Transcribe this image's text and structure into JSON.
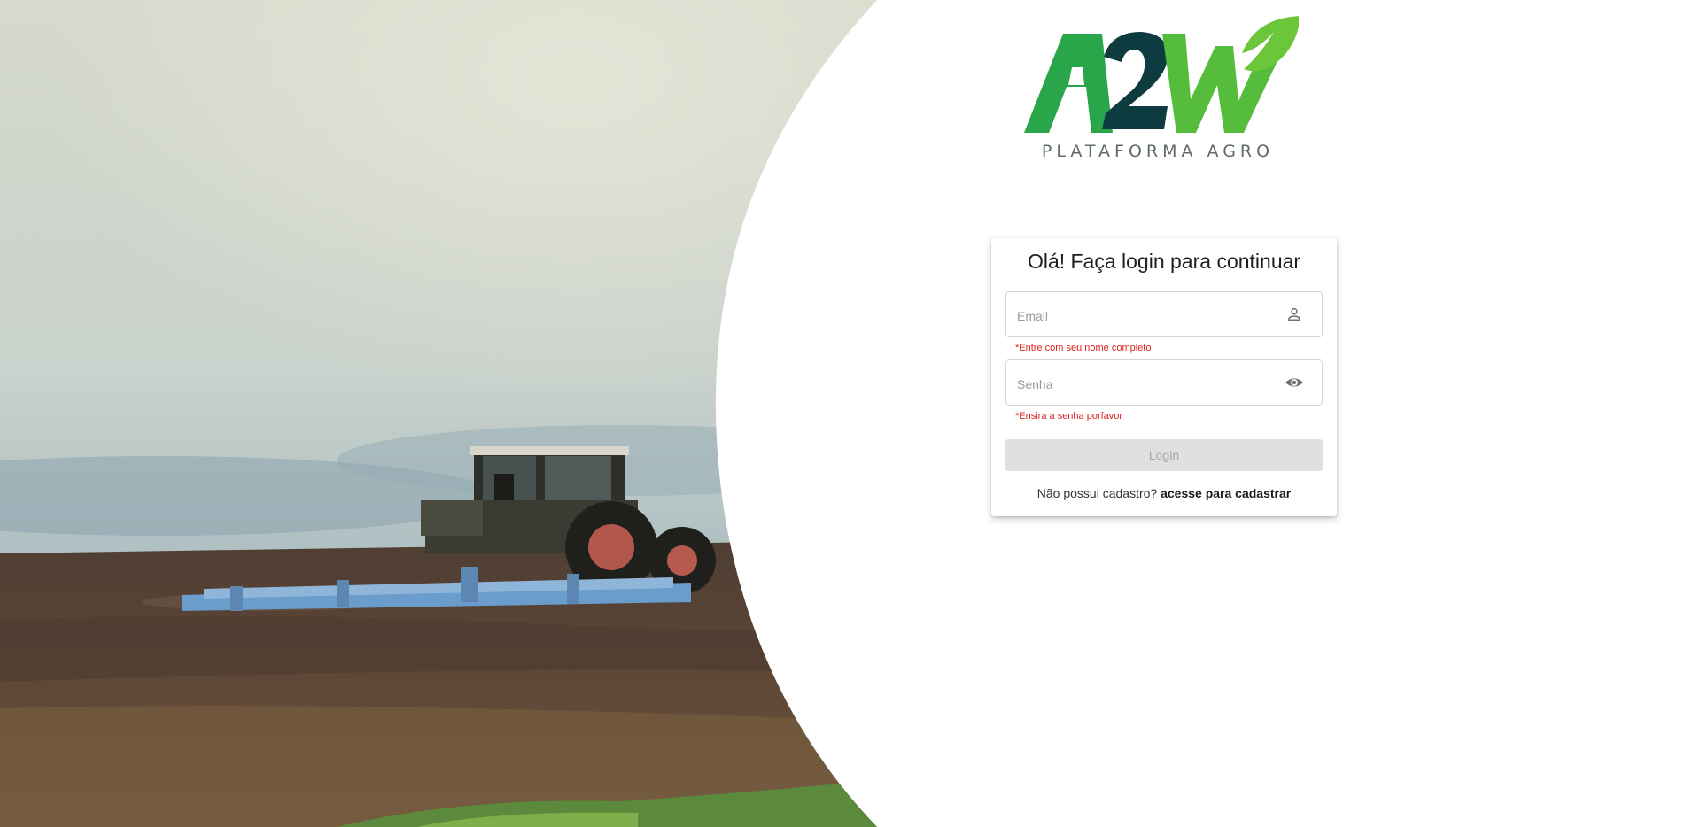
{
  "hero": {
    "description_icon": "tractor-field-photo"
  },
  "logo": {
    "mark": "A2W",
    "tagline": "PLATAFORMA AGRO",
    "colors": {
      "green": "#2dab4a",
      "dark": "#0e3b3f",
      "light_green": "#6cc63a"
    }
  },
  "login": {
    "title": "Olá! Faça login para continuar",
    "email": {
      "placeholder": "Email",
      "value": "",
      "icon": "person-icon",
      "error": "*Entre com seu nome completo"
    },
    "password": {
      "placeholder": "Senha",
      "value": "",
      "icon": "eye-icon",
      "error": "*Ensira a senha porfavor"
    },
    "submit_label": "Login",
    "signup_prompt": "Não possui cadastro?",
    "signup_link": "acesse para cadastrar"
  },
  "colors": {
    "error": "#e02020",
    "button_disabled_bg": "#e0e0e0",
    "button_disabled_text": "#a6a6a6"
  }
}
